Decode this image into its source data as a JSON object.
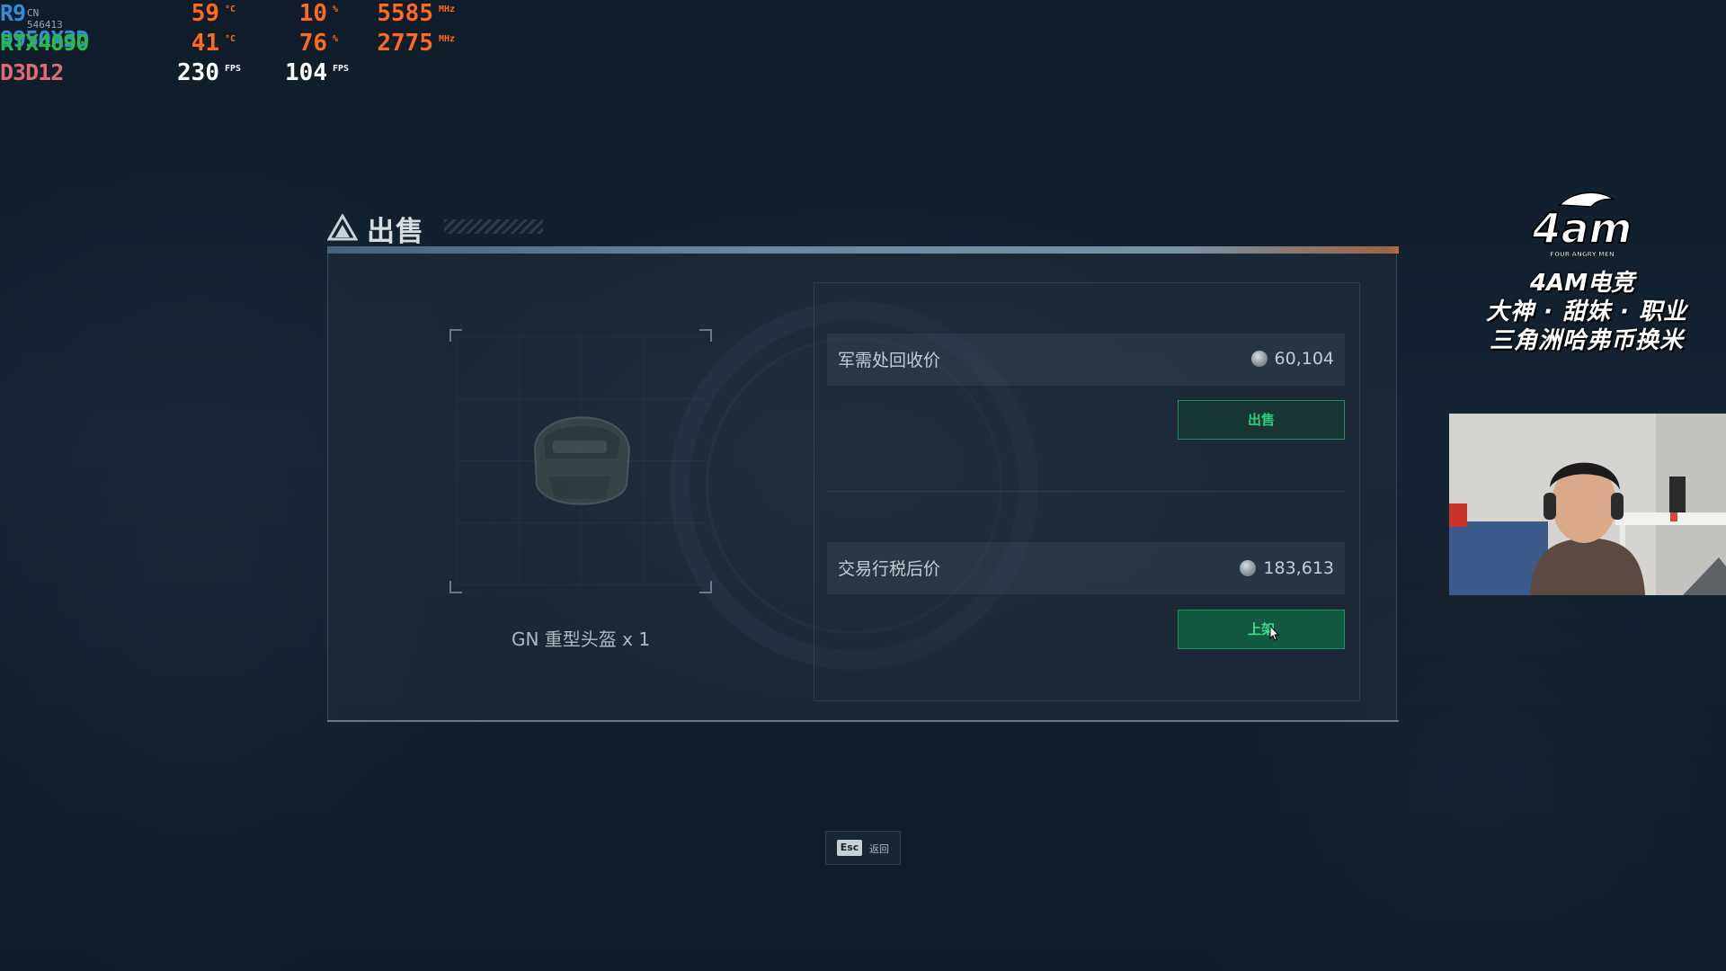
{
  "hud": {
    "cpu": {
      "label": "R9 9950X3D",
      "extra": "CN 546413",
      "temp": "59",
      "temp_unit": "°C",
      "load": "10",
      "load_unit": "%",
      "clock": "5585",
      "clock_unit": "MHz"
    },
    "gpu": {
      "label": "RTX4090",
      "temp": "41",
      "temp_unit": "°C",
      "load": "76",
      "load_unit": "%",
      "clock": "2775",
      "clock_unit": "MHz"
    },
    "api": {
      "label": "D3D12",
      "fps1": "230",
      "fps1_unit": "FPS",
      "fps2": "104",
      "fps2_unit": "FPS"
    },
    "colors": {
      "cpu": "#2f8fd8",
      "gpu": "#2fb84a",
      "api": "#e06a73",
      "values": "#ff6a1f",
      "fps": "#ffffff"
    }
  },
  "panel": {
    "title": "出售",
    "item": {
      "name": "GN 重型头盔 x 1",
      "icon": "helmet-icon"
    },
    "recycle": {
      "label": "军需处回收价",
      "price": "60,104",
      "button": "出售"
    },
    "trade": {
      "label": "交易行税后价",
      "price": "183,613",
      "button": "上架"
    },
    "accent_color": "#27d07c"
  },
  "footer": {
    "key": "Esc",
    "label": "返回"
  },
  "overlay": {
    "logo_text": "4am",
    "logo_sub": "FOUR ANGRY MEN",
    "brand": "4AM电竞",
    "tagline1": "大神 · 甜妹 · 职业",
    "tagline2": "三角洲哈弗币换米"
  }
}
